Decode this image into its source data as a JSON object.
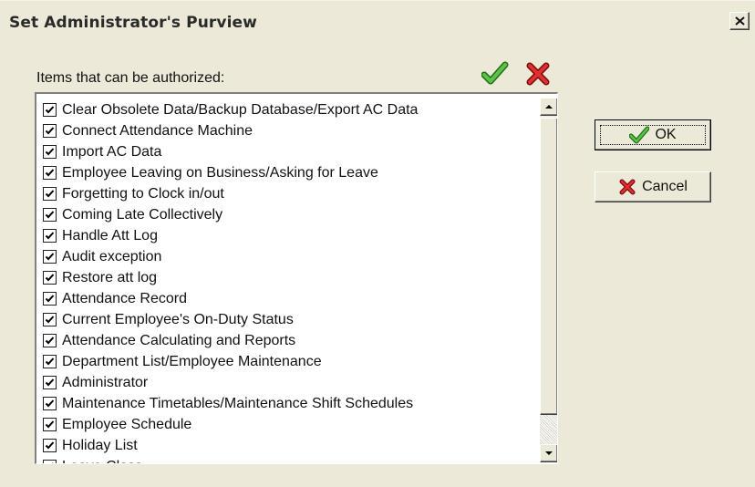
{
  "window": {
    "title": "Set Administrator's Purview"
  },
  "list": {
    "label": "Items that can be authorized:",
    "items": [
      "Clear Obsolete Data/Backup Database/Export AC Data",
      "Connect Attendance Machine",
      "Import AC Data",
      "Employee Leaving on Business/Asking for Leave",
      "Forgetting to Clock in/out",
      "Coming Late Collectively",
      "Handle Att Log",
      "Audit exception",
      "Restore att log",
      "Attendance Record",
      "Current Employee's On-Duty Status",
      "Attendance Calculating and Reports",
      "Department List/Employee Maintenance",
      "Administrator",
      "Maintenance Timetables/Maintenance Shift Schedules",
      "Employee Schedule",
      "Holiday List",
      "Leave Class"
    ],
    "all_checked": true
  },
  "buttons": {
    "ok": "OK",
    "cancel": "Cancel"
  },
  "icons": {
    "select_all": "green-check-icon",
    "deselect_all": "red-x-icon",
    "close": "close-icon"
  },
  "colors": {
    "check_green": "#39a52c",
    "cross_red": "#c81a1a",
    "background": "#ece9d8"
  }
}
